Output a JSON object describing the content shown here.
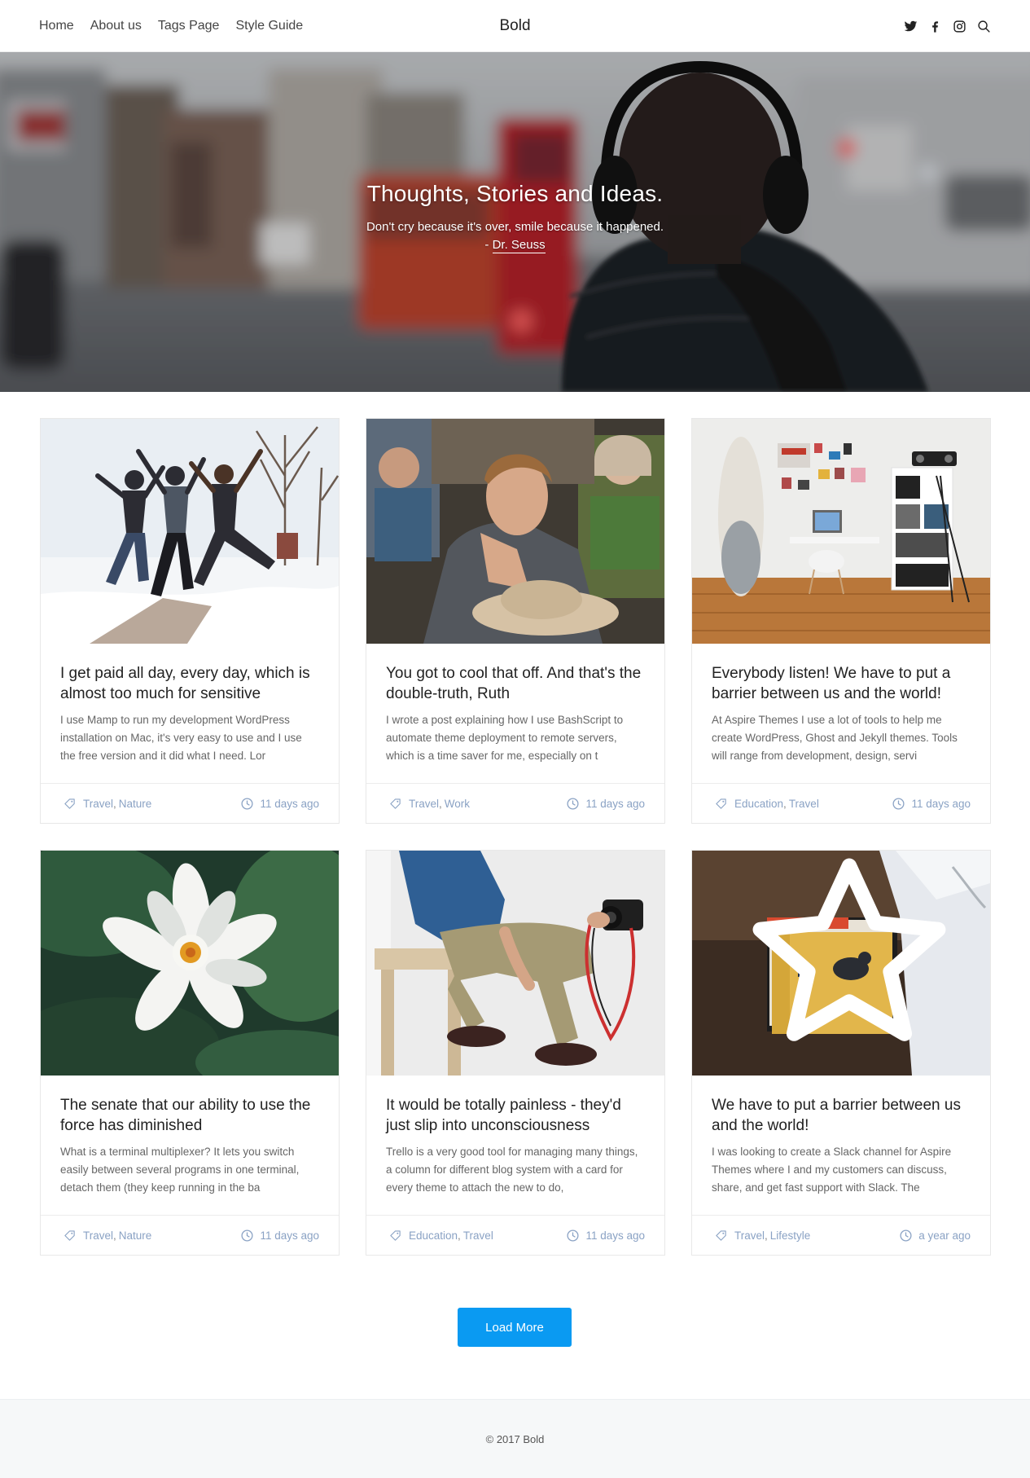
{
  "nav": {
    "links": [
      "Home",
      "About us",
      "Tags Page",
      "Style Guide"
    ],
    "brand": "Bold",
    "icons": [
      "twitter-icon",
      "facebook-icon",
      "instagram-icon",
      "search-icon"
    ]
  },
  "hero": {
    "title": "Thoughts, Stories and Ideas.",
    "quote": "Don't cry because it's over, smile because it happened.",
    "author_prefix": "- ",
    "author": "Dr. Seuss"
  },
  "posts": [
    {
      "title": "I get paid all day, every day, which is almost too much for sensitive",
      "excerpt": "I use Mamp to run my development WordPress installation on Mac, it's very easy to use and I use the free version and it did what I need. Lor",
      "tags": [
        "Travel",
        "Nature"
      ],
      "date": "11 days ago",
      "image": "friends-jumping-in-snow",
      "featured": false
    },
    {
      "title": "You got to cool that off. And that's the double-truth, Ruth",
      "excerpt": "I wrote a post explaining how I use BashScript to automate theme deployment to remote servers, which is a time saver for me, especially on t",
      "tags": [
        "Travel",
        "Work"
      ],
      "date": "11 days ago",
      "image": "man-in-crowd-with-hat",
      "featured": false
    },
    {
      "title": "Everybody listen! We have to put a barrier between us and the world!",
      "excerpt": "At Aspire Themes I use a lot of tools to help me create WordPress, Ghost and Jekyll themes. Tools will range from development, design, servi",
      "tags": [
        "Education",
        "Travel"
      ],
      "date": "11 days ago",
      "image": "workspace-with-surfboard",
      "featured": false
    },
    {
      "title": "The senate that our ability to use the force has diminished",
      "excerpt": "What is a terminal multiplexer? It lets you switch easily between several programs in one terminal, detach them (they keep running in the ba",
      "tags": [
        "Travel",
        "Nature"
      ],
      "date": "11 days ago",
      "image": "white-water-lily",
      "featured": false
    },
    {
      "title": "It would be totally painless - they'd just slip into unconsciousness",
      "excerpt": "Trello is a very good tool for managing many things, a column for different blog system with a card for every theme to attach the new to do,",
      "tags": [
        "Education",
        "Travel"
      ],
      "date": "11 days ago",
      "image": "man-holding-camera",
      "featured": false
    },
    {
      "title": "We have to put a barrier between us and the world!",
      "excerpt": "I was looking to create a Slack channel for Aspire Themes where I and my customers can discuss, share, and get fast support with Slack. The",
      "tags": [
        "Travel",
        "Lifestyle"
      ],
      "date": "a year ago",
      "image": "stack-of-books",
      "featured": true
    }
  ],
  "load_more_label": "Load More",
  "footer": {
    "copyright": "© 2017 Bold"
  },
  "colors": {
    "accent": "#0a9af2",
    "tag_link": "#8aa2c4",
    "footer_bg": "#f6f8f9"
  }
}
